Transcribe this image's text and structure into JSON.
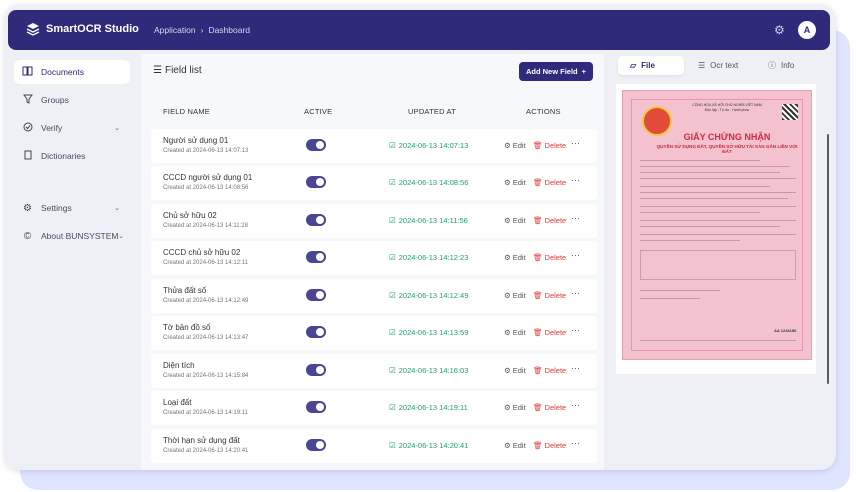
{
  "app": {
    "name": "SmartOCR Studio",
    "avatar_letter": "A"
  },
  "breadcrumb": {
    "root": "Application",
    "sep": "›",
    "current": "Dashboard"
  },
  "sidebar": {
    "items": [
      {
        "label": "Documents",
        "icon": "book-icon",
        "active": true
      },
      {
        "label": "Groups",
        "icon": "filter-icon",
        "active": false
      },
      {
        "label": "Verify",
        "icon": "check-circle-icon",
        "active": false,
        "chevron": true
      },
      {
        "label": "Dictionaries",
        "icon": "book-closed-icon",
        "active": false
      },
      {
        "label": "Settings",
        "icon": "gear-icon",
        "active": false,
        "chevron": true
      },
      {
        "label": "About BUNSYSTEM",
        "icon": "copyright-icon",
        "active": false,
        "chevron": true
      }
    ]
  },
  "main": {
    "title": "Field list",
    "add_button": "Add New Field",
    "columns": {
      "name": "FIELD NAME",
      "active": "ACTIVE",
      "updated": "UPDATED AT",
      "actions": "ACTIONS"
    },
    "edit_label": "Edit",
    "delete_label": "Delete",
    "more_label": "···",
    "rows": [
      {
        "name": "Người sử dụng 01",
        "created": "Created at 2024-06-13 14:07:13",
        "updated": "2024-06-13 14:07:13",
        "active": true
      },
      {
        "name": "CCCD người sử dụng 01",
        "created": "Created at 2024-06-13 14:08:56",
        "updated": "2024-06-13 14:08:56",
        "active": true
      },
      {
        "name": "Chủ sở hữu 02",
        "created": "Created at 2024-06-13 14:11:28",
        "updated": "2024-06-13 14:11:56",
        "active": true
      },
      {
        "name": "CCCD chủ sở hữu 02",
        "created": "Created at 2024-06-13 14:12:11",
        "updated": "2024-06-13 14:12:23",
        "active": true
      },
      {
        "name": "Thửa đất số",
        "created": "Created at 2024-06-13 14:12:49",
        "updated": "2024-06-13 14:12:49",
        "active": true
      },
      {
        "name": "Tờ bản đồ số",
        "created": "Created at 2024-06-13 14:13:47",
        "updated": "2024-06-13 14:13:59",
        "active": true
      },
      {
        "name": "Diện tích",
        "created": "Created at 2024-06-13 14:15:84",
        "updated": "2024-06-13 14:16:03",
        "active": true
      },
      {
        "name": "Loại đất",
        "created": "Created at 2024-06-13 14:19:11",
        "updated": "2024-06-13 14:19:11",
        "active": true
      },
      {
        "name": "Thời hạn sử dụng đất",
        "created": "Created at 2024-06-13 14:20:41",
        "updated": "2024-06-13 14:20:41",
        "active": true
      }
    ]
  },
  "preview": {
    "tabs": [
      {
        "label": "File",
        "icon": "file-icon",
        "active": true
      },
      {
        "label": "Ocr text",
        "icon": "lines-icon",
        "active": false
      },
      {
        "label": "Info",
        "icon": "info-icon",
        "active": false
      }
    ],
    "doc_header": "CỘNG HÒA XÃ HỘI CHỦ NGHĨA VIỆT NAM\nĐộc lập - Tự do - Hạnh phúc",
    "doc_title": "GIẤY CHỨNG NHẬN",
    "doc_subtitle": "QUYỀN SỬ DỤNG ĐẤT, QUYỀN SỞ HỮU TÀI SẢN GẮN LIỀN VỚI ĐẤT",
    "doc_serial": "AA 1234156"
  },
  "colors": {
    "primary": "#2f2a7a",
    "success": "#22a06b",
    "danger": "#e03a3a",
    "toggle": "#4b4694"
  }
}
